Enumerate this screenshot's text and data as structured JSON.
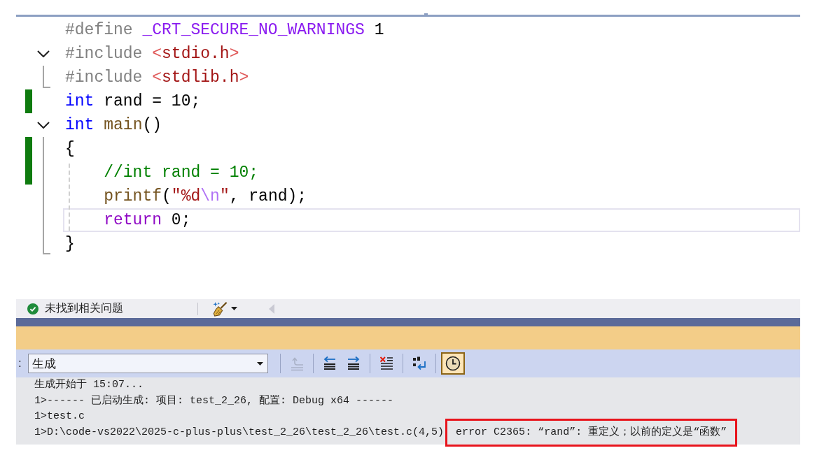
{
  "editor": {
    "lines": [
      {
        "tokens": [
          {
            "kind": "preprocessor",
            "text": "#define "
          },
          {
            "kind": "macro",
            "text": "_CRT_SECURE_NO_WARNINGS"
          },
          {
            "kind": "number",
            "text": " 1"
          }
        ],
        "changed": false,
        "current": false
      },
      {
        "tokens": [
          {
            "kind": "preprocessor",
            "text": "#include "
          },
          {
            "kind": "angle",
            "text": "<"
          },
          {
            "kind": "header",
            "text": "stdio.h"
          },
          {
            "kind": "angle",
            "text": ">"
          }
        ],
        "changed": false,
        "current": false,
        "expanded": true,
        "children": [
          {
            "tokens": [
              {
                "kind": "preprocessor",
                "text": "#include "
              },
              {
                "kind": "angle",
                "text": "<"
              },
              {
                "kind": "header",
                "text": "stdlib.h"
              },
              {
                "kind": "angle",
                "text": ">"
              }
            ],
            "changed": false,
            "current": false
          }
        ]
      },
      {
        "tokens": [
          {
            "kind": "keyword",
            "text": "int"
          },
          {
            "kind": "identifier",
            "text": " rand = "
          },
          {
            "kind": "number",
            "text": "10"
          },
          {
            "kind": "punct",
            "text": ";"
          }
        ],
        "changed": true,
        "current": false
      },
      {
        "tokens": [
          {
            "kind": "keyword",
            "text": "int"
          },
          {
            "kind": "function",
            "text": " main"
          },
          {
            "kind": "punct",
            "text": "()"
          }
        ],
        "changed": false,
        "current": false,
        "expanded": true,
        "children": [
          {
            "tokens": [
              {
                "kind": "punct",
                "text": "{"
              }
            ],
            "changed": true,
            "current": false
          },
          {
            "tokens": [
              {
                "kind": "comment",
                "text": "    //int rand = 10;"
              }
            ],
            "changed": true,
            "current": false
          },
          {
            "tokens": [
              {
                "kind": "function",
                "text": "    printf"
              },
              {
                "kind": "punct",
                "text": "("
              },
              {
                "kind": "string",
                "text": "\"%d"
              },
              {
                "kind": "escape",
                "text": "\\n"
              },
              {
                "kind": "string",
                "text": "\""
              },
              {
                "kind": "punct",
                "text": ", rand);"
              }
            ],
            "changed": false,
            "current": false
          },
          {
            "tokens": [
              {
                "kind": "flow",
                "text": "    return"
              },
              {
                "kind": "number",
                "text": " 0"
              },
              {
                "kind": "punct",
                "text": ";"
              }
            ],
            "changed": false,
            "current": true
          },
          {
            "tokens": [
              {
                "kind": "punct",
                "text": "}"
              }
            ],
            "changed": false,
            "current": false
          }
        ]
      }
    ]
  },
  "error_list": {
    "issues_found": false,
    "status": "未找到相关问题",
    "left_arrow": {
      "disabled": true
    }
  },
  "output": {
    "toolbar": {
      "source_label": ":",
      "source": "生成",
      "button_groups": [
        [
          {
            "kind": "go-to-source",
            "disabled": true,
            "pressed": false
          }
        ],
        [
          {
            "kind": "previous-message",
            "disabled": false,
            "pressed": false
          },
          {
            "kind": "next-message",
            "disabled": false,
            "pressed": false
          }
        ],
        [
          {
            "kind": "clear-all",
            "disabled": false,
            "pressed": false
          }
        ],
        [
          {
            "kind": "word-wrap",
            "disabled": false,
            "pressed": false
          }
        ],
        [
          {
            "kind": "timestamps",
            "disabled": false,
            "pressed": true
          }
        ]
      ]
    },
    "lines": [
      {
        "text": "生成开始于 15:07..."
      },
      {
        "text": "1>------ 已启动生成: 项目: test_2_26, 配置: Debug x64 ------"
      },
      {
        "text": "1>test.c"
      },
      {
        "text": "1>D:\\code-vs2022\\2025-c-plus-plus\\test_2_26\\test_2_26\\test.c(4,5)",
        "highlighted": "error C2365: “rand”: 重定义；以前的定义是“函数”"
      }
    ]
  }
}
